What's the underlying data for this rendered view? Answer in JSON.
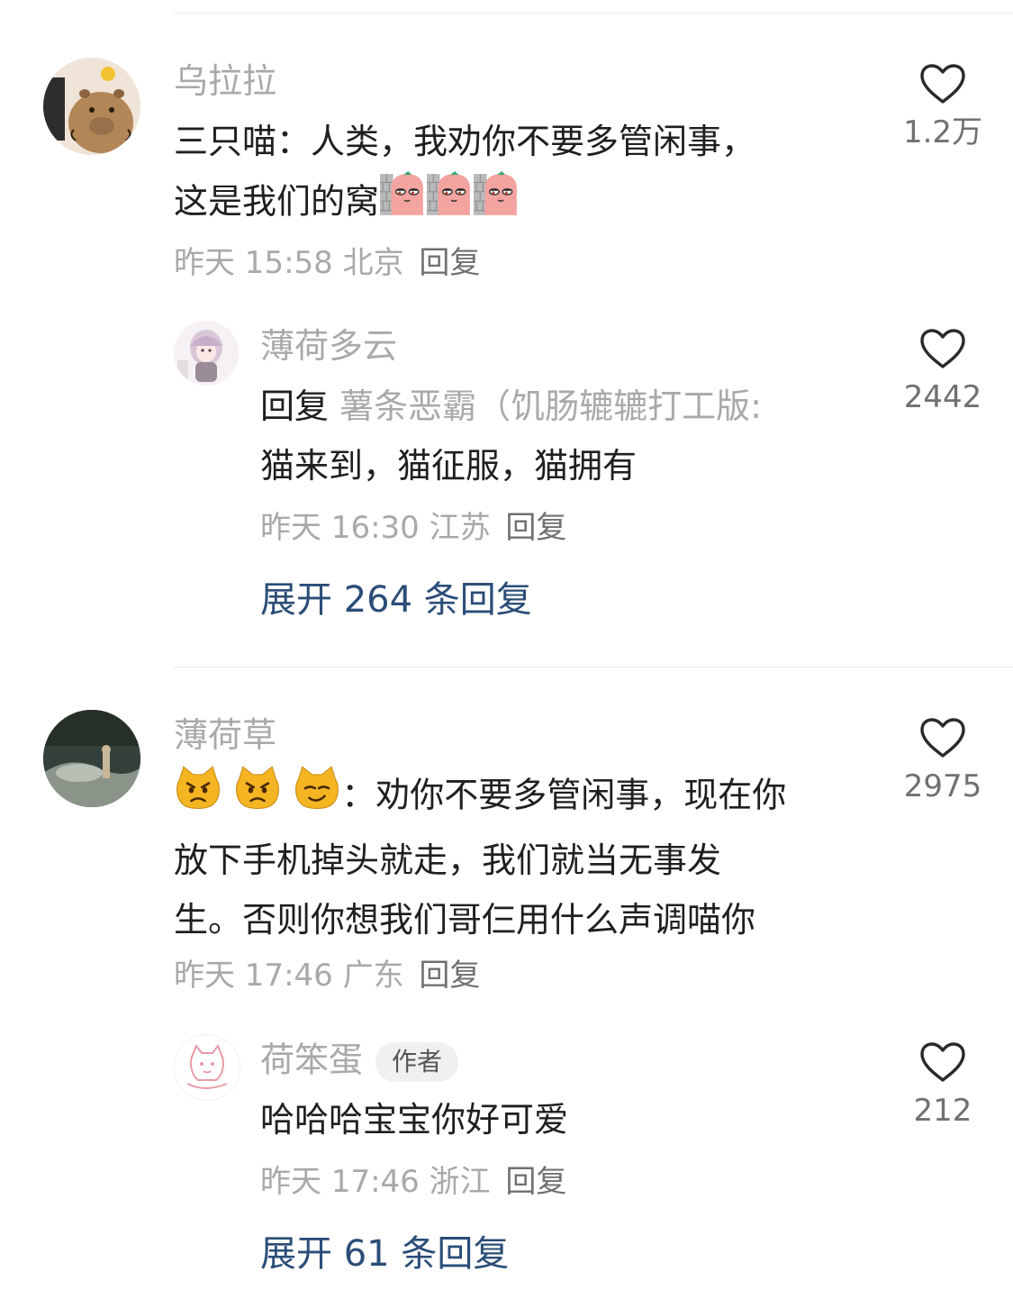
{
  "comments": [
    {
      "username": "乌拉拉",
      "text_line1": "三只喵：人类，我劝你不要多管闲事，",
      "text_line2": "这是我们的窝",
      "time": "昨天 15:58",
      "location": "北京",
      "reply_label": "回复",
      "likes": "1.2万",
      "replies": [
        {
          "username": "薄荷多云",
          "reply_prefix": "回复",
          "reply_to": "薯条恶霸（饥肠辘辘打工版:",
          "text": "猫来到，猫征服，猫拥有",
          "time": "昨天 16:30",
          "location": "江苏",
          "reply_label": "回复",
          "likes": "2442"
        }
      ],
      "expand_label": "展开 264 条回复"
    },
    {
      "username": "薄荷草",
      "text_line1": "：劝你不要多管闲事，现在你",
      "text_line2": "放下手机掉头就走，我们就当无事发",
      "text_line3": "生。否则你想我们哥仨用什么声调喵你",
      "time": "昨天 17:46",
      "location": "广东",
      "reply_label": "回复",
      "likes": "2975",
      "replies": [
        {
          "username": "荷笨蛋",
          "badge": "作者",
          "text": "哈哈哈宝宝你好可爱",
          "time": "昨天 17:46",
          "location": "浙江",
          "reply_label": "回复",
          "likes": "212"
        }
      ],
      "expand_label": "展开 61 条回复"
    }
  ],
  "icons": {
    "like": "heart-outline-icon",
    "sticker": "sausage-peek-sticker",
    "cat_emoji": "angry-cat-emoji"
  },
  "colors": {
    "username": "#a9a9a9",
    "meta": "#a9a9a9",
    "expand_link": "#2b4d77",
    "text": "#1f1f1f"
  }
}
